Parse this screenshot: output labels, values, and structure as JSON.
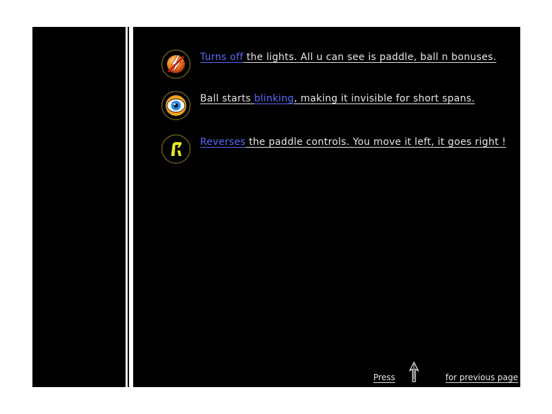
{
  "powerups": [
    {
      "icon": "lightning-icon",
      "highlight": "Turns off",
      "text": " the lights. All u can see is paddle, ball n bonuses."
    },
    {
      "icon": "eye-icon",
      "prefix": "Ball starts ",
      "highlight": "blinking",
      "text": ", making it invisible for short spans."
    },
    {
      "icon": "reverse-icon",
      "highlight": "Reverses",
      "text": " the paddle controls. You move it left, it goes right !"
    }
  ],
  "footer": {
    "press_label": "Press",
    "arrow_icon": "up-arrow-icon",
    "suffix_label": "for previous page"
  },
  "colors": {
    "background": "#000000",
    "text": "#e8e8e8",
    "highlight": "#5b6cff",
    "icon_ring": "#6b5a1a"
  }
}
